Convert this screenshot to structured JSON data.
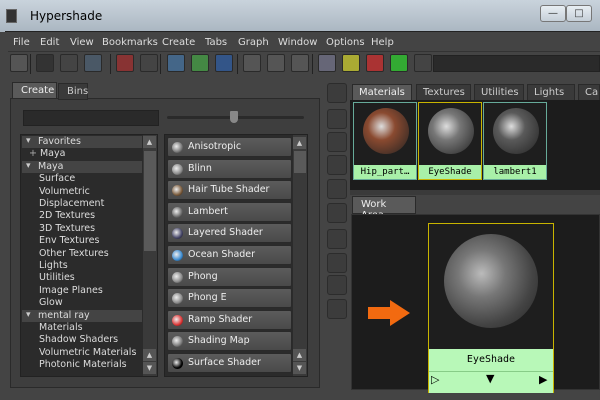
{
  "window": {
    "title": "Hypershade",
    "controls": [
      "minimize",
      "maximize"
    ]
  },
  "menu": [
    "File",
    "Edit",
    "View",
    "Bookmarks",
    "Create",
    "Tabs",
    "Graph",
    "Window",
    "Options",
    "Help"
  ],
  "left_tabs": [
    "Create",
    "Bins"
  ],
  "tree": {
    "favorites": "Favorites",
    "favorites_children": [
      "Maya"
    ],
    "maya": "Maya",
    "maya_children": [
      "Surface",
      "Volumetric",
      "Displacement",
      "2D Textures",
      "3D Textures",
      "Env Textures",
      "Other Textures",
      "Lights",
      "Utilities",
      "Image Planes",
      "Glow"
    ],
    "mental_ray": "mental ray",
    "mental_ray_children": [
      "Materials",
      "Shadow Shaders",
      "Volumetric Materials",
      "Photonic Materials"
    ]
  },
  "shaders": [
    {
      "label": "Anisotropic",
      "color": "#777"
    },
    {
      "label": "Blinn",
      "color": "#888"
    },
    {
      "label": "Hair Tube Shader",
      "color": "#7a5a3a"
    },
    {
      "label": "Lambert",
      "color": "#666"
    },
    {
      "label": "Layered Shader",
      "color": "#446"
    },
    {
      "label": "Ocean Shader",
      "color": "#3a8ad0"
    },
    {
      "label": "Phong",
      "color": "#888"
    },
    {
      "label": "Phong E",
      "color": "#888"
    },
    {
      "label": "Ramp Shader",
      "color": "#d33"
    },
    {
      "label": "Shading Map",
      "color": "#777"
    },
    {
      "label": "Surface Shader",
      "color": "#000"
    }
  ],
  "top_tabs": [
    "Materials",
    "Textures",
    "Utilities",
    "Lights",
    "Ca"
  ],
  "materials": [
    {
      "label": "Hip_part…",
      "color": "#8a4a30"
    },
    {
      "label": "EyeShade",
      "color": "#777"
    },
    {
      "label": "lambert1",
      "color": "#5a5a5a"
    }
  ],
  "work_area": {
    "tab": "Work Area",
    "node_label": "EyeShade"
  },
  "colors": {
    "accent": "#a8f0a8",
    "selection": "#c8b400",
    "arrow": "#f26a10"
  }
}
